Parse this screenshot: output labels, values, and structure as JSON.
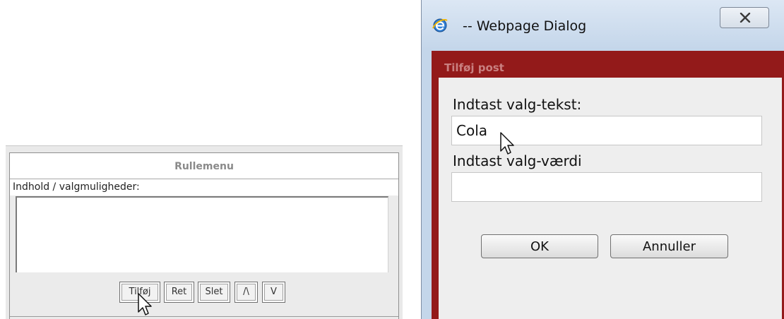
{
  "rullemenu": {
    "title": "Rullemenu",
    "content_label": "Indhold / valgmuligheder:",
    "buttons": {
      "add": "Tilføj",
      "edit": "Ret",
      "delete": "Slet",
      "up": "/\\",
      "down": "V"
    }
  },
  "dialog": {
    "window_title": "-- Webpage Dialog",
    "close_icon": "close-x-icon",
    "header": "Tilføj post",
    "text_label": "Indtast valg-tekst:",
    "text_value": "Cola",
    "value_label": "Indtast valg-værdi",
    "value_value": "",
    "ok_label": "OK",
    "cancel_label": "Annuller"
  },
  "colors": {
    "dialog_frame": "#931a1a",
    "dialog_chrome": "#c4d6ea",
    "panel_bg": "#e9e9e9"
  }
}
